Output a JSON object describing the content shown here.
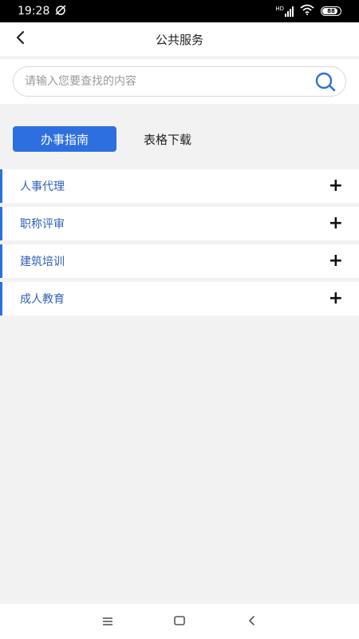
{
  "status_bar": {
    "time": "19:28",
    "network": "HD",
    "battery": "88",
    "battery_level": 0.88
  },
  "header": {
    "title": "公共服务",
    "back_icon": "chevron-left-icon"
  },
  "search": {
    "placeholder": "请输入您要查找的内容",
    "value": "",
    "icon": "search-icon"
  },
  "tabs": [
    {
      "label": "办事指南",
      "active": true
    },
    {
      "label": "表格下载",
      "active": false
    }
  ],
  "list": {
    "items": [
      {
        "label": "人事代理",
        "icon": "plus-icon"
      },
      {
        "label": "职称评审",
        "icon": "plus-icon"
      },
      {
        "label": "建筑培训",
        "icon": "plus-icon"
      },
      {
        "label": "成人教育",
        "icon": "plus-icon"
      }
    ]
  },
  "nav": {
    "menu_icon": "menu-icon",
    "home_icon": "home-icon",
    "back_icon": "back-icon"
  },
  "colors": {
    "accent": "#2e6fe0",
    "item_text": "#2f5fb8",
    "background": "#f2f2f2"
  }
}
